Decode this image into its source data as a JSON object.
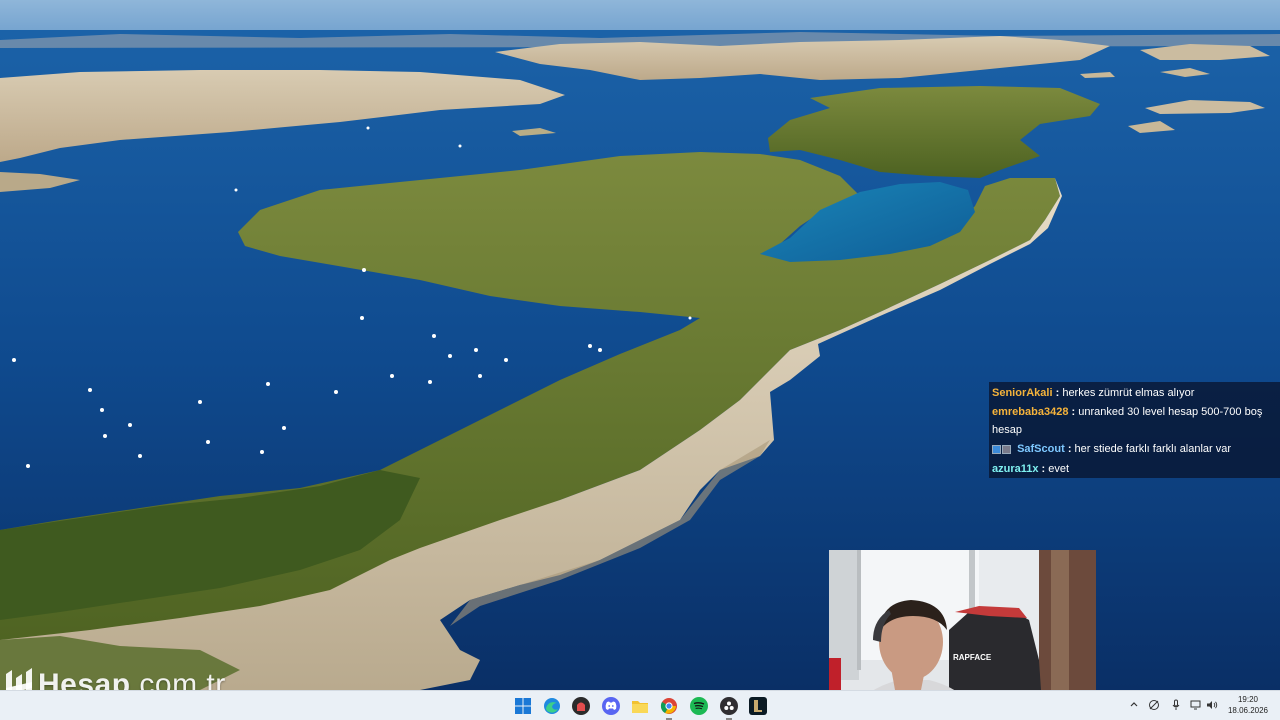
{
  "wallpaper": {
    "description_icon": "island-landscape-wallpaper"
  },
  "chat": {
    "messages": [
      {
        "user": "SeniorAkali",
        "color": "#f5b33b",
        "text": " herkes zümrüt elmas alıyor",
        "badges": false
      },
      {
        "user": "emrebaba3428",
        "color": "#f5b33b",
        "text": " unranked 30 level hesap 500-700 boş hesap",
        "badges": false
      },
      {
        "user": "SafScout",
        "color": "#7ec8ff",
        "text": " her stiede farklı farklı alanlar var",
        "badges": true
      },
      {
        "user": "azura11x",
        "color": "#7ff0f0",
        "text": " evet",
        "badges": false
      }
    ],
    "separator": ":"
  },
  "watermark": {
    "brand": "Hesap",
    "suffix": ".com.tr"
  },
  "taskbar": {
    "apps": [
      {
        "name": "windows-start-icon"
      },
      {
        "name": "edge-browser-icon"
      },
      {
        "name": "game-app-icon"
      },
      {
        "name": "discord-icon"
      },
      {
        "name": "file-explorer-icon"
      },
      {
        "name": "chrome-icon"
      },
      {
        "name": "spotify-icon"
      },
      {
        "name": "obs-studio-icon"
      },
      {
        "name": "league-of-legends-icon"
      }
    ],
    "tray": {
      "icons": [
        "chevron-up-icon",
        "network-off-icon",
        "microphone-icon",
        "display-icon",
        "speaker-icon"
      ]
    },
    "clock": {
      "time": "19:20",
      "date": "18.06.2026"
    }
  },
  "webcam": {
    "chair_brand": "RAPFACE"
  }
}
